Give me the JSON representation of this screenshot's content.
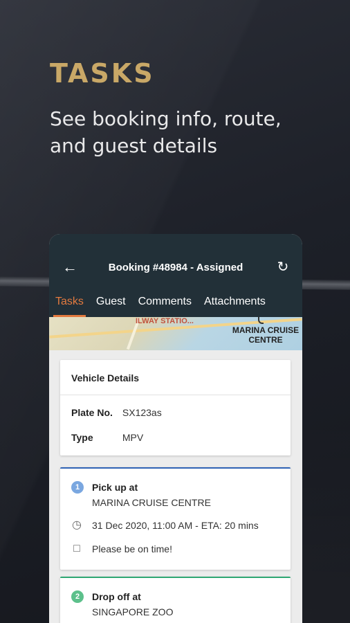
{
  "promo": {
    "headline": "TASKS",
    "subhead": "See booking info, route, and guest details"
  },
  "appbar": {
    "title": "Booking #48984 - Assigned",
    "back_icon": "arrow-left-icon",
    "refresh_icon": "refresh-icon"
  },
  "tabs": [
    {
      "label": "Tasks",
      "active": true
    },
    {
      "label": "Guest",
      "active": false
    },
    {
      "label": "Comments",
      "active": false
    },
    {
      "label": "Attachments",
      "active": false
    }
  ],
  "map": {
    "label_station": "ILWAY STATIO...",
    "label_place": "MARINA CRUISE CENTRE"
  },
  "vehicle": {
    "title": "Vehicle Details",
    "plate_label": "Plate No.",
    "plate_value": "SX123as",
    "type_label": "Type",
    "type_value": "MPV"
  },
  "tasks": [
    {
      "number": "1",
      "label": "Pick up at",
      "place": "MARINA CRUISE CENTRE",
      "datetime": "31 Dec 2020, 11:00 AM - ETA: 20 mins",
      "note": "Please be on time!",
      "accent": "#2f63b5"
    },
    {
      "number": "2",
      "label": "Drop off at",
      "place": "SINGAPORE ZOO",
      "accent": "#2fa873"
    }
  ],
  "colors": {
    "accent_gold": "#c9a867",
    "appbar": "#223038",
    "tab_active": "#e27a3f"
  }
}
